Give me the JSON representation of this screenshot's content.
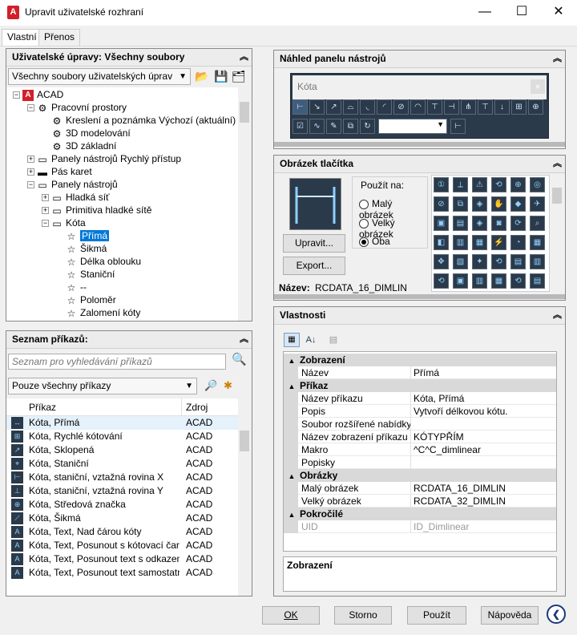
{
  "window": {
    "title": "Upravit uživatelské rozhraní",
    "app_icon": "A",
    "minimize": "—",
    "maximize": "☐",
    "close": "✕"
  },
  "tabs": [
    "Vlastní",
    "Přenos"
  ],
  "customizations": {
    "title": "Uživatelské úpravy: Všechny soubory",
    "file_combo": "Všechny soubory uživatelských úprav",
    "tree": [
      {
        "label": "ACAD",
        "level": 0,
        "exp": "−",
        "icon": "acad-icon"
      },
      {
        "label": "Pracovní prostory",
        "level": 1,
        "exp": "−",
        "icon": "gear-icon"
      },
      {
        "label": "Kreslení a poznámka Výchozí (aktuální)",
        "level": 2,
        "exp": "",
        "icon": "gear-icon"
      },
      {
        "label": "3D modelování",
        "level": 2,
        "exp": "",
        "icon": "gear-icon"
      },
      {
        "label": "3D základní",
        "level": 2,
        "exp": "",
        "icon": "gear-icon"
      },
      {
        "label": "Panely nástrojů Rychlý přístup",
        "level": 1,
        "exp": "+",
        "icon": "toolbar-icon"
      },
      {
        "label": "Pás karet",
        "level": 1,
        "exp": "+",
        "icon": "folder-icon"
      },
      {
        "label": "Panely nástrojů",
        "level": 1,
        "exp": "−",
        "icon": "toolbar-icon"
      },
      {
        "label": "Hladká síť",
        "level": 2,
        "exp": "+",
        "icon": "toolbar-icon"
      },
      {
        "label": "Primitiva hladké sítě",
        "level": 2,
        "exp": "+",
        "icon": "toolbar-icon"
      },
      {
        "label": "Kóta",
        "level": 2,
        "exp": "−",
        "icon": "toolbar-icon"
      },
      {
        "label": "Přímá",
        "level": 3,
        "exp": "",
        "icon": "star-icon",
        "selected": true
      },
      {
        "label": "Šikmá",
        "level": 3,
        "exp": "",
        "icon": "star-icon"
      },
      {
        "label": "Délka oblouku",
        "level": 3,
        "exp": "",
        "icon": "star-icon"
      },
      {
        "label": "Staniční",
        "level": 3,
        "exp": "",
        "icon": "star-icon"
      },
      {
        "label": "--",
        "level": 3,
        "exp": "",
        "icon": "star-icon"
      },
      {
        "label": "Poloměr",
        "level": 3,
        "exp": "",
        "icon": "star-icon"
      },
      {
        "label": "Zalomení kóty",
        "level": 3,
        "exp": "",
        "icon": "star-icon"
      }
    ]
  },
  "command_list": {
    "title": "Seznam příkazů:",
    "search_placeholder": "Seznam pro vyhledávání příkazů",
    "filter": "Pouze všechny příkazy",
    "col_command": "Příkaz",
    "col_source": "Zdroj",
    "rows": [
      {
        "name": "Kóta, Přímá",
        "src": "ACAD"
      },
      {
        "name": "Kóta, Rychlé kótování",
        "src": "ACAD"
      },
      {
        "name": "Kóta, Sklopená",
        "src": "ACAD"
      },
      {
        "name": "Kóta, Staniční",
        "src": "ACAD"
      },
      {
        "name": "Kóta, staniční, vztažná rovina X",
        "src": "ACAD"
      },
      {
        "name": "Kóta, staniční, vztažná rovina Y",
        "src": "ACAD"
      },
      {
        "name": "Kóta, Středová značka",
        "src": "ACAD"
      },
      {
        "name": "Kóta, Šikmá",
        "src": "ACAD"
      },
      {
        "name": "Kóta, Text, Nad čárou kóty",
        "src": "ACAD"
      },
      {
        "name": "Kóta, Text, Posunout s kótovací čarou",
        "src": "ACAD"
      },
      {
        "name": "Kóta, Text, Posunout text s odkazem",
        "src": "ACAD"
      },
      {
        "name": "Kóta, Text, Posunout text samostatně",
        "src": "ACAD"
      }
    ]
  },
  "toolbar_preview": {
    "title": "Náhled panelu nástrojů",
    "toolbar_name": "Kóta",
    "close": "×"
  },
  "button_image": {
    "title": "Obrázek tlačítka",
    "use_label": "Použít na:",
    "options": [
      "Malý obrázek",
      "Velký obrázek",
      "Oba"
    ],
    "selected_option": "Oba",
    "edit_label": "Upravit...",
    "export_label": "Export...",
    "name_label": "Název:",
    "name_value": "RCDATA_16_DIMLIN"
  },
  "properties": {
    "title": "Vlastnosti",
    "groups": [
      {
        "name": "Zobrazení",
        "items": [
          {
            "k": "Název",
            "v": "Přímá"
          }
        ]
      },
      {
        "name": "Příkaz",
        "items": [
          {
            "k": "Název příkazu",
            "v": "Kóta, Přímá"
          },
          {
            "k": "Popis",
            "v": "Vytvoří délkovou kótu."
          },
          {
            "k": "Soubor rozšířené nabídky",
            "v": ""
          },
          {
            "k": "Název zobrazení příkazu",
            "v": "KÓTYPŘÍM"
          },
          {
            "k": "Makro",
            "v": "^C^C_dimlinear"
          },
          {
            "k": "Popisky",
            "v": ""
          }
        ]
      },
      {
        "name": "Obrázky",
        "items": [
          {
            "k": "Malý obrázek",
            "v": "RCDATA_16_DIMLIN"
          },
          {
            "k": "Velký obrázek",
            "v": "RCDATA_32_DIMLIN"
          }
        ]
      },
      {
        "name": "Pokročilé",
        "items": [
          {
            "k": "UID",
            "v": "ID_Dimlinear",
            "dim": true
          }
        ]
      }
    ],
    "description_title": "Zobrazení"
  },
  "footer": {
    "ok": "OK",
    "cancel": "Storno",
    "apply": "Použít",
    "help": "Nápověda"
  }
}
